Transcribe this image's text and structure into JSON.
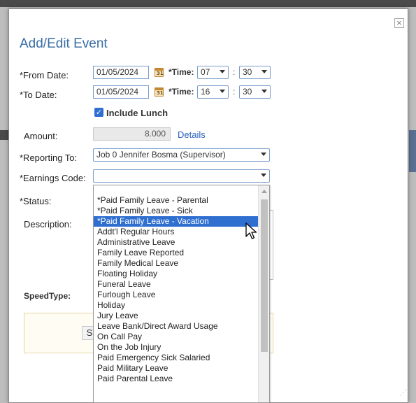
{
  "dialog": {
    "title": "Add/Edit Event",
    "close_label": "×",
    "from_date": {
      "label": "*From Date:",
      "value": "01/05/2024",
      "time_label": "*Time:",
      "hour": "07",
      "minute": "30"
    },
    "to_date": {
      "label": "*To Date:",
      "value": "01/05/2024",
      "time_label": "*Time:",
      "hour": "16",
      "minute": "30"
    },
    "include_lunch": {
      "label": "Include Lunch",
      "checked": true
    },
    "amount": {
      "label": "Amount:",
      "value": "8.000",
      "details_link": "Details"
    },
    "reporting_to": {
      "label": "*Reporting To:",
      "value": "Job 0 Jennifer Bosma (Supervisor)"
    },
    "earnings_code": {
      "label": "*Earnings Code:",
      "value": ""
    },
    "status": {
      "label": "*Status:"
    },
    "description": {
      "label": "Description:"
    },
    "speedtype": {
      "label": "SpeedType:"
    },
    "save_label": "S",
    "colon": ":"
  },
  "calendar_icon_glyph": "31",
  "dropdown": {
    "options": [
      "*Paid Family Leave - Parental",
      "*Paid Family Leave - Sick",
      "*Paid Family Leave - Vacation",
      "Addt'l Regular Hours",
      "Administrative Leave",
      "Family Leave Reported",
      "Family Medical Leave",
      "Floating Holiday",
      "Funeral Leave",
      "Furlough Leave",
      "Holiday",
      "Jury Leave",
      "Leave Bank/Direct Award Usage",
      "On Call Pay",
      "On the Job Injury",
      "Paid Emergency Sick Salaried",
      "Paid Military Leave",
      "Paid Parental Leave"
    ],
    "selected_index": 2
  },
  "colors": {
    "accent": "#2f6fd0",
    "title": "#3a6ea5",
    "link": "#2a62b8"
  }
}
